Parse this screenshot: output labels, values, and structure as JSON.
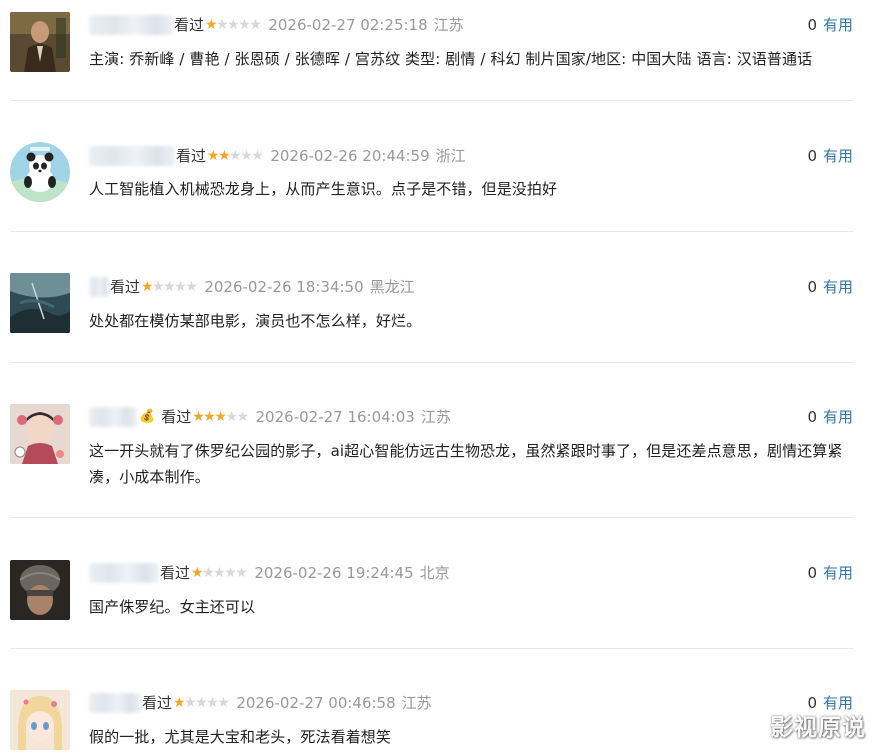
{
  "comments": [
    {
      "status": "看过",
      "rating": 1,
      "time": "2026-02-27 02:25:18",
      "location": "江苏",
      "votes": "0",
      "useful_label": "有用",
      "text": "主演: 乔新峰 / 曹艳 / 张恩硕 / 张德晖 / 宫苏纹 类型: 剧情 / 科幻 制片国家/地区: 中国大陆 语言: 汉语普通话"
    },
    {
      "status": "看过",
      "rating": 2,
      "time": "2026-02-26 20:44:59",
      "location": "浙江",
      "votes": "0",
      "useful_label": "有用",
      "text": "人工智能植入机械恐龙身上，从而产生意识。点子是不错，但是没拍好"
    },
    {
      "status": "看过",
      "rating": 1,
      "time": "2026-02-26 18:34:50",
      "location": "黑龙江",
      "votes": "0",
      "useful_label": "有用",
      "text": "处处都在模仿某部电影，演员也不怎么样，好烂。"
    },
    {
      "status": "看过",
      "rating": 3,
      "time": "2026-02-27 16:04:03",
      "location": "江苏",
      "votes": "0",
      "useful_label": "有用",
      "text": "这一开头就有了侏罗纪公园的影子，ai超心智能仿远古生物恐龙，虽然紧跟时事了，但是还差点意思，剧情还算紧凑，小成本制作。"
    },
    {
      "status": "看过",
      "rating": 1,
      "time": "2026-02-26 19:24:45",
      "location": "北京",
      "votes": "0",
      "useful_label": "有用",
      "text": "国产侏罗纪。女主还可以"
    },
    {
      "status": "看过",
      "rating": 1,
      "time": "2026-02-27 00:46:58",
      "location": "江苏",
      "votes": "0",
      "useful_label": "有用",
      "text": "假的一批，尤其是大宝和老头，死法看着想笑"
    }
  ],
  "watermark": "影视原说"
}
